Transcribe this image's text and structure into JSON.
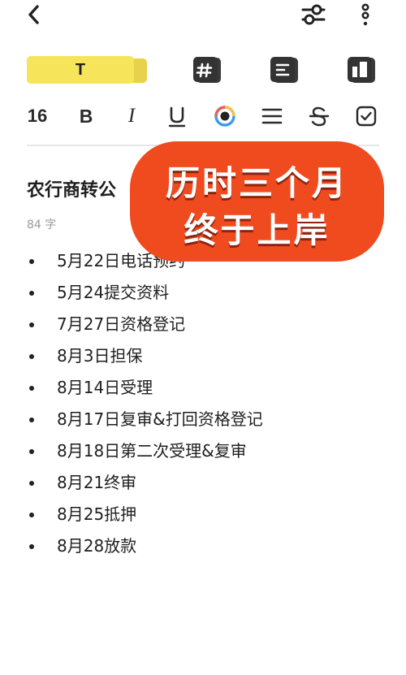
{
  "toolbar": {
    "icons": [
      "chevron-left-icon",
      "filter-sliders-icon",
      "more-vertical-icon"
    ]
  },
  "styles": {
    "text_style_label": "T",
    "accent": "#f6e45a",
    "other_icons": [
      "hash-style-icon",
      "lines-style-icon",
      "columns-style-icon"
    ]
  },
  "format": {
    "font_size": "16",
    "bold": "B",
    "italic": "I",
    "underline": "U",
    "icons": [
      "text-color-icon",
      "align-icon",
      "strikethrough-icon",
      "checkbox-icon"
    ]
  },
  "note": {
    "title": "农行商转公",
    "word_count": "84 字",
    "items": [
      "5月22日电话预约",
      "5月24提交资料",
      " 7月27日资格登记",
      "8月3日担保",
      "8月14日受理",
      "8月17日复审&打回资格登记",
      "8月18日第二次受理&复审",
      "8月21终审",
      "8月25抵押",
      "8月28放款"
    ]
  },
  "sticker": {
    "line1": "历时三个月",
    "line2": "终于上岸",
    "color": "#f04a1f"
  }
}
